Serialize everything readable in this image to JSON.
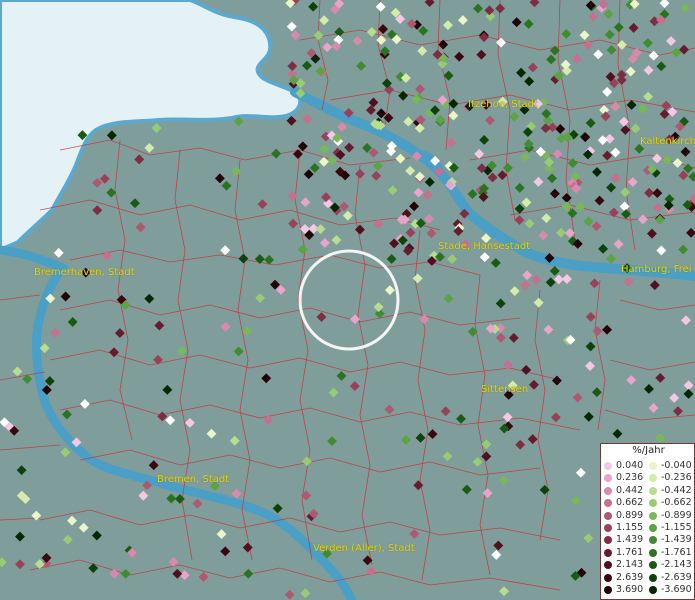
{
  "map": {
    "cities": [
      {
        "id": "bremerhaven",
        "label": "Bremerhaven, Stadt"
      },
      {
        "id": "bremen",
        "label": "Bremen, Stadt"
      },
      {
        "id": "verden",
        "label": "Verden (Aller), Stadt"
      },
      {
        "id": "stade",
        "label": "Stade, Hansestadt"
      },
      {
        "id": "hamburg",
        "label": "Hamburg, Frei"
      },
      {
        "id": "itzehoe",
        "label": "Itzehoe, Stadt"
      },
      {
        "id": "kaltenkirchen",
        "label": "Kaltenkirch"
      },
      {
        "id": "sittensen",
        "label": "Sittensen"
      }
    ],
    "colors": {
      "land": "#7f9d9a",
      "sea": "#e4f1f5",
      "river": "#4a9fc6",
      "boundary": "#c8343a",
      "label": "#e2d719"
    }
  },
  "legend": {
    "title": "%/Jahr",
    "rows": [
      {
        "pos": "0.040",
        "neg": "-0.040",
        "pos_color": "#f4c8e4",
        "neg_color": "#eaf5c8"
      },
      {
        "pos": "0.236",
        "neg": "-0.236",
        "pos_color": "#e6a5c9",
        "neg_color": "#d3ecaa"
      },
      {
        "pos": "0.442",
        "neg": "-0.442",
        "pos_color": "#d88aae",
        "neg_color": "#b7dd8f"
      },
      {
        "pos": "0.662",
        "neg": "-0.662",
        "pos_color": "#c5708f",
        "neg_color": "#97cc74"
      },
      {
        "pos": "0.899",
        "neg": "-0.899",
        "pos_color": "#af5873",
        "neg_color": "#78b85a"
      },
      {
        "pos": "1.155",
        "neg": "-1.155",
        "pos_color": "#97425a",
        "neg_color": "#5ba344"
      },
      {
        "pos": "1.439",
        "neg": "-1.439",
        "pos_color": "#7e2d43",
        "neg_color": "#408c31"
      },
      {
        "pos": "1.761",
        "neg": "-1.761",
        "pos_color": "#661c2f",
        "neg_color": "#2a7421"
      },
      {
        "pos": "2.143",
        "neg": "-2.143",
        "pos_color": "#4f101f",
        "neg_color": "#1a5b14"
      },
      {
        "pos": "2.639",
        "neg": "-2.639",
        "pos_color": "#380711",
        "neg_color": "#0e420b"
      },
      {
        "pos": "3.690",
        "neg": "-3.690",
        "pos_color": "#200208",
        "neg_color": "#052804"
      }
    ]
  }
}
